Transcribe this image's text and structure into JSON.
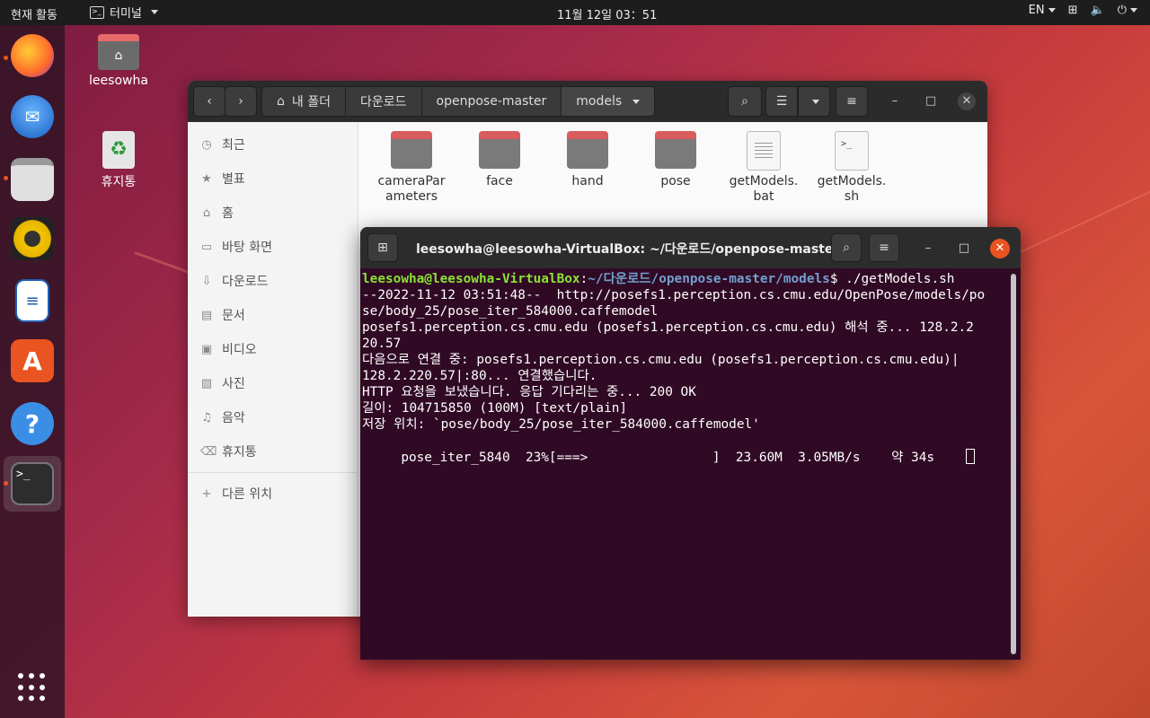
{
  "topbar": {
    "activities": "현재 활동",
    "app_name": "터미널",
    "clock": "11월 12일  03：51",
    "lang": "EN"
  },
  "desktop": {
    "home_label": "leesowha",
    "trash_label": "휴지통"
  },
  "files": {
    "crumbs": [
      "내 폴더",
      "다운로드",
      "openpose-master",
      "models"
    ],
    "sidebar": [
      "최근",
      "별표",
      "홈",
      "바탕 화면",
      "다운로드",
      "문서",
      "비디오",
      "사진",
      "음악",
      "휴지통"
    ],
    "other_locations": "다른 위치",
    "items": [
      {
        "name1": "cameraPar",
        "name2": "ameters",
        "type": "folder"
      },
      {
        "name1": "face",
        "name2": "",
        "type": "folder"
      },
      {
        "name1": "hand",
        "name2": "",
        "type": "folder"
      },
      {
        "name1": "pose",
        "name2": "",
        "type": "folder"
      },
      {
        "name1": "getModels.",
        "name2": "bat",
        "type": "text"
      },
      {
        "name1": "getModels.",
        "name2": "sh",
        "type": "script"
      }
    ]
  },
  "terminal": {
    "title": "leesowha@leesowha-VirtualBox: ~/다운로드/openpose-maste...",
    "prompt_user": "leesowha@leesowha-VirtualBox",
    "prompt_path": "~/다운로드/openpose-master/models",
    "command": "$ ./getModels.sh",
    "lines": [
      "--2022-11-12 03:51:48--  http://posefs1.perception.cs.cmu.edu/OpenPose/models/po",
      "se/body_25/pose_iter_584000.caffemodel",
      "posefs1.perception.cs.cmu.edu (posefs1.perception.cs.cmu.edu) 해석 중... 128.2.2",
      "20.57",
      "다음으로 연결 중: posefs1.perception.cs.cmu.edu (posefs1.perception.cs.cmu.edu)|",
      "128.2.220.57|:80... 연결했습니다.",
      "HTTP 요청을 보냈습니다. 응답 기다리는 중... 200 OK",
      "길이: 104715850 (100M) [text/plain]",
      "저장 위치: `pose/body_25/pose_iter_584000.caffemodel'",
      ""
    ],
    "progress_line": "     pose_iter_5840  23%[===>                ]  23.60M  3.05MB/s    약 34s    "
  }
}
